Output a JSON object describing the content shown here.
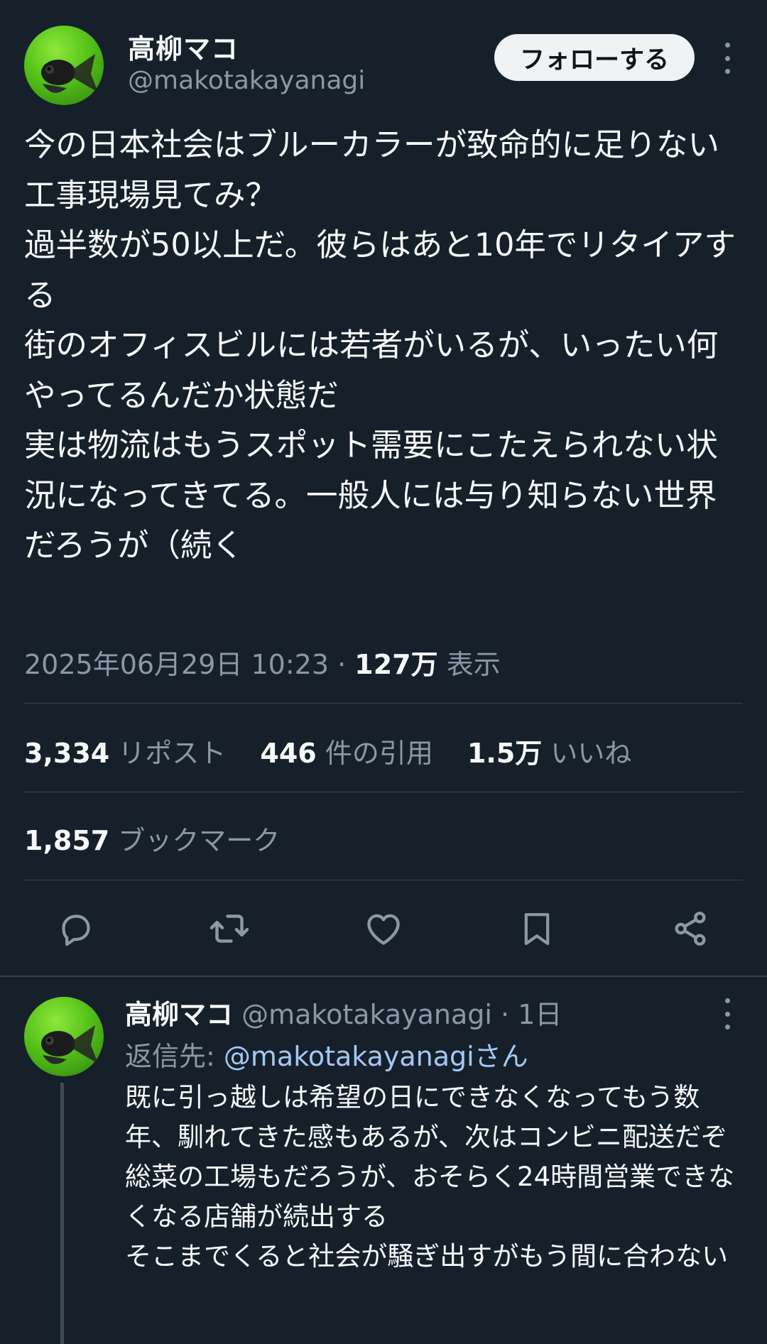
{
  "tweet": {
    "author_name": "高柳マコ",
    "author_handle": "@makotakayanagi",
    "follow_label": "フォローする",
    "text": "今の日本社会はブルーカラーが致命的に足りない\n工事現場見てみ？\n過半数が50以上だ。彼らはあと10年でリタイアする\n街のオフィスビルには若者がいるが、いったい何やってるんだか状態だ\n実は物流はもうスポット需要にこたえられない状況になってきてる。一般人には与り知らない世界だろうが（続く",
    "timestamp": "2025年06月29日 10:23",
    "separator": " · ",
    "views_count": "127万",
    "views_label": "表示"
  },
  "stats": [
    {
      "count": "3,334",
      "label": "リポスト"
    },
    {
      "count": "446",
      "label": "件の引用"
    },
    {
      "count": "1.5万",
      "label": "いいね"
    }
  ],
  "bookmarks": {
    "count": "1,857",
    "label": "ブックマーク"
  },
  "actions": [
    "reply-icon",
    "retweet-icon",
    "like-icon",
    "bookmark-icon",
    "share-icon"
  ],
  "reply": {
    "author_name": "高柳マコ",
    "author_handle": "@makotakayanagi",
    "time": " · 1日",
    "reply_to_prefix": "返信先: ",
    "reply_to_mention": "@makotakayanagiさん",
    "text": "既に引っ越しは希望の日にできなくなってもう数年、馴れてきた感もあるが、次はコンビニ配送だぞ\n総菜の工場もだろうが、おそらく24時間営業できなくなる店舗が続出する\nそこまでくると社会が騒ぎ出すがもう間に合わない"
  },
  "colors": {
    "background": "#15202b",
    "text_primary": "#f7f9f9",
    "text_secondary": "#8b98a5",
    "divider": "#38444d",
    "mention": "#a3c8f5"
  }
}
